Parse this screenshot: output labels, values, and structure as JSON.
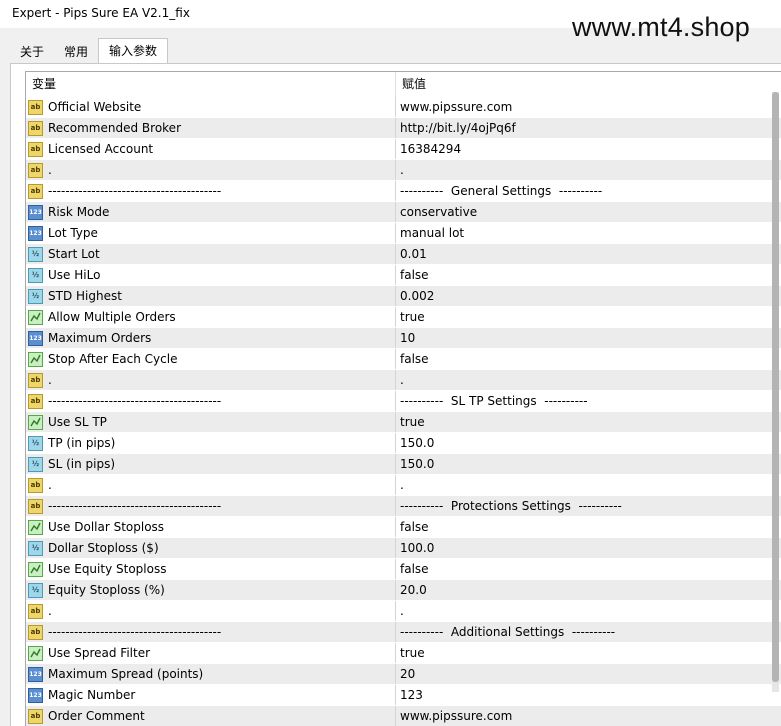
{
  "window": {
    "title": "Expert - Pips Sure EA V2.1_fix",
    "watermark": "www.mt4.shop"
  },
  "tabs": [
    {
      "label": "关于",
      "active": false
    },
    {
      "label": "常用",
      "active": false
    },
    {
      "label": "输入参数",
      "active": true
    }
  ],
  "table": {
    "headers": {
      "variable": "变量",
      "value": "赋值"
    },
    "rows": [
      {
        "type": "ab",
        "icon": "string-type-icon",
        "name": "Official Website",
        "value": "www.pipssure.com"
      },
      {
        "type": "ab",
        "icon": "string-type-icon",
        "name": "Recommended Broker",
        "value": "http://bit.ly/4ojPq6f"
      },
      {
        "type": "ab",
        "icon": "string-type-icon",
        "name": "Licensed Account",
        "value": "16384294"
      },
      {
        "type": "ab",
        "icon": "string-type-icon",
        "name": ".",
        "value": "."
      },
      {
        "type": "ab",
        "icon": "string-type-icon",
        "name": "----------------------------------------",
        "value": "----------  General Settings  ----------"
      },
      {
        "type": "num",
        "icon": "integer-type-icon",
        "name": "Risk Mode",
        "value": "conservative"
      },
      {
        "type": "num",
        "icon": "integer-type-icon",
        "name": "Lot Type",
        "value": "manual lot"
      },
      {
        "type": "frac",
        "icon": "double-type-icon",
        "name": "Start Lot",
        "value": "0.01"
      },
      {
        "type": "frac",
        "icon": "double-type-icon",
        "name": "Use HiLo",
        "value": "false"
      },
      {
        "type": "frac",
        "icon": "double-type-icon",
        "name": "STD Highest",
        "value": "0.002"
      },
      {
        "type": "bool",
        "icon": "boolean-type-icon",
        "name": "Allow Multiple Orders",
        "value": "true"
      },
      {
        "type": "num",
        "icon": "integer-type-icon",
        "name": "Maximum Orders",
        "value": "10"
      },
      {
        "type": "bool",
        "icon": "boolean-type-icon",
        "name": "Stop After Each Cycle",
        "value": "false"
      },
      {
        "type": "ab",
        "icon": "string-type-icon",
        "name": ".",
        "value": "."
      },
      {
        "type": "ab",
        "icon": "string-type-icon",
        "name": "----------------------------------------",
        "value": "----------  SL TP Settings  ----------"
      },
      {
        "type": "bool",
        "icon": "boolean-type-icon",
        "name": "Use SL TP",
        "value": "true"
      },
      {
        "type": "frac",
        "icon": "double-type-icon",
        "name": "TP (in pips)",
        "value": "150.0"
      },
      {
        "type": "frac",
        "icon": "double-type-icon",
        "name": "SL (in pips)",
        "value": "150.0"
      },
      {
        "type": "ab",
        "icon": "string-type-icon",
        "name": ".",
        "value": "."
      },
      {
        "type": "ab",
        "icon": "string-type-icon",
        "name": "----------------------------------------",
        "value": "----------  Protections Settings  ----------"
      },
      {
        "type": "bool",
        "icon": "boolean-type-icon",
        "name": "Use Dollar Stoploss",
        "value": "false"
      },
      {
        "type": "frac",
        "icon": "double-type-icon",
        "name": "Dollar Stoploss ($)",
        "value": "100.0"
      },
      {
        "type": "bool",
        "icon": "boolean-type-icon",
        "name": "Use Equity Stoploss",
        "value": "false"
      },
      {
        "type": "frac",
        "icon": "double-type-icon",
        "name": "Equity Stoploss (%)",
        "value": "20.0"
      },
      {
        "type": "ab",
        "icon": "string-type-icon",
        "name": ".",
        "value": "."
      },
      {
        "type": "ab",
        "icon": "string-type-icon",
        "name": "----------------------------------------",
        "value": "----------  Additional Settings  ----------"
      },
      {
        "type": "bool",
        "icon": "boolean-type-icon",
        "name": "Use Spread Filter",
        "value": "true"
      },
      {
        "type": "num",
        "icon": "integer-type-icon",
        "name": "Maximum Spread (points)",
        "value": "20"
      },
      {
        "type": "num",
        "icon": "integer-type-icon",
        "name": "Magic Number",
        "value": "123"
      },
      {
        "type": "ab",
        "icon": "string-type-icon",
        "name": "Order Comment",
        "value": "www.pipssure.com"
      }
    ]
  },
  "colors": {
    "alt_row": "#ececec",
    "string_icon": "#efd66a",
    "integer_icon": "#5b8fd0",
    "double_icon": "#9fd6e8",
    "boolean_icon": "#c8eec2"
  }
}
